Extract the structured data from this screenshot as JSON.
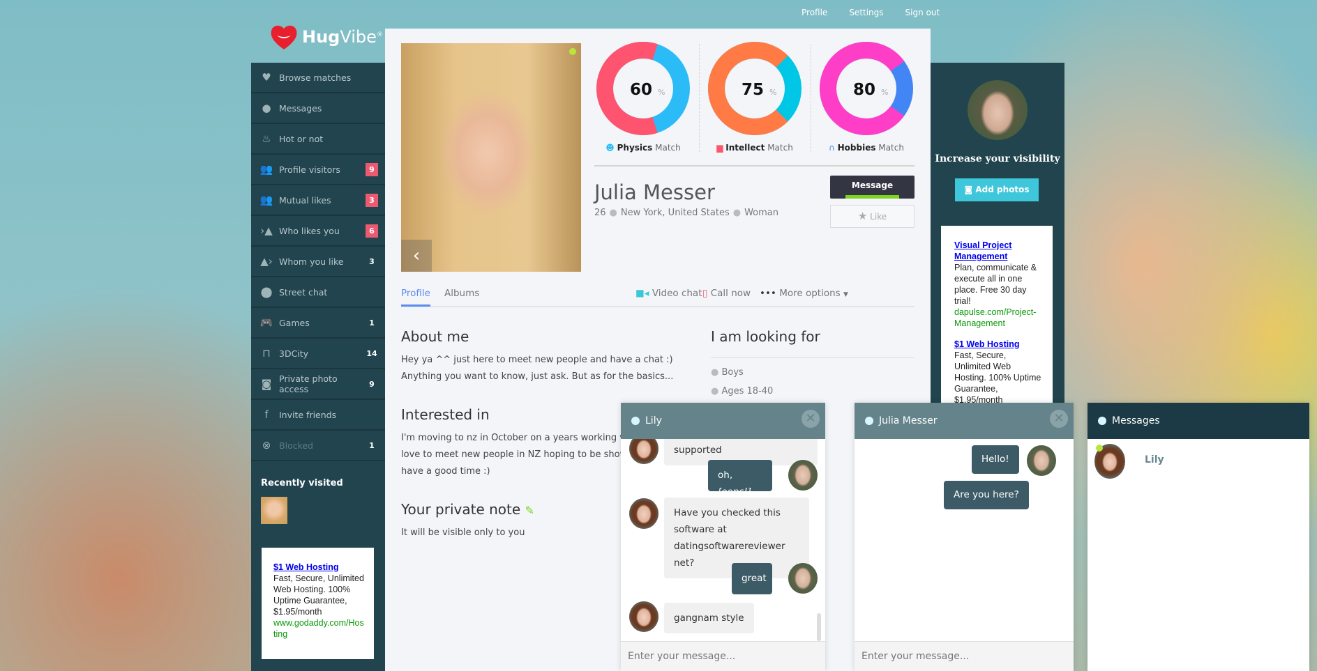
{
  "topnav": {
    "items": [
      "Profile",
      "Settings",
      "Sign out"
    ]
  },
  "logo": {
    "text_bold": "Hug",
    "text_light": "Vibe",
    "mark": "®",
    "brand_color": "#e8202e"
  },
  "sidebar": {
    "items": [
      {
        "label": "Browse matches",
        "icon": "heart-icon",
        "count": null
      },
      {
        "label": "Messages",
        "icon": "chat-bubble-icon",
        "count": null
      },
      {
        "label": "Hot or not",
        "icon": "flame-icon",
        "count": null
      },
      {
        "label": "Profile visitors",
        "icon": "users-icon",
        "count": "9",
        "badge": "red"
      },
      {
        "label": "Mutual likes",
        "icon": "users-heart-icon",
        "count": "3",
        "badge": "red"
      },
      {
        "label": "Who likes you",
        "icon": "user-incoming-icon",
        "count": "6",
        "badge": "red"
      },
      {
        "label": "Whom you like",
        "icon": "user-outgoing-icon",
        "count": "3"
      },
      {
        "label": "Street chat",
        "icon": "map-pin-icon",
        "count": null
      },
      {
        "label": "Games",
        "icon": "gamepad-icon",
        "count": "1"
      },
      {
        "label": "3DCity",
        "icon": "vr-glasses-icon",
        "count": "14"
      },
      {
        "label": "Private photo access",
        "icon": "camera-icon",
        "count": "9"
      },
      {
        "label": "Invite friends",
        "icon": "facebook-icon",
        "count": null
      },
      {
        "label": "Blocked",
        "icon": "blocked-icon",
        "count": "1",
        "dim": true
      }
    ],
    "recently_visited": "Recently visited",
    "ad": {
      "title": "$1 Web Hosting",
      "body": "Fast, Secure, Unlimited Web Hosting. 100% Uptime Guarantee, $1.95/month",
      "url": "www.godaddy.com/Hosting"
    }
  },
  "profile": {
    "name": "Julia Messer",
    "age": "26",
    "location": "New York, United States",
    "gender": "Woman",
    "message_button": "Message",
    "like_button": "Like",
    "matches": [
      {
        "value": 60,
        "display": "60",
        "unit": "%",
        "label_bold": "Physics",
        "label": "Match",
        "colors": [
          "#ff5470",
          "#2bbcf8"
        ],
        "icon": "smiley-icon",
        "icon_color": "#2bbcf8"
      },
      {
        "value": 75,
        "display": "75",
        "unit": "%",
        "label_bold": "Intellect",
        "label": "Match",
        "colors": [
          "#ff7a45",
          "#00c7e6"
        ],
        "icon": "book-icon",
        "icon_color": "#ff5470"
      },
      {
        "value": 80,
        "display": "80",
        "unit": "%",
        "label_bold": "Hobbies",
        "label": "Match",
        "colors": [
          "#ff3ec8",
          "#4385f4"
        ],
        "icon": "headphones-icon",
        "icon_color": "#4385f4"
      }
    ],
    "tabs": [
      {
        "label": "Profile",
        "active": true
      },
      {
        "label": "Albums"
      }
    ],
    "actions": [
      {
        "label": "Video chat",
        "icon": "video-icon"
      },
      {
        "label": "Call now",
        "icon": "phone-icon"
      },
      {
        "label": "More options",
        "icon": "more-dots-icon"
      }
    ],
    "about_title": "About me",
    "about_lines": [
      "Hey ya ^^ just here to meet new people and have a chat :)",
      "Anything you want to know, just ask. But as for the basics..."
    ],
    "interested_title": "Interested in",
    "interested_lines": [
      "I'm moving to nz in October on a years working visa and would",
      "love to meet new people in NZ hoping to be shown around and",
      "have a good time :)"
    ],
    "note_title": "Your private note",
    "note_text": "It will be visible only to you",
    "looking_title": "I am looking for",
    "looking_items": [
      "Boys",
      "Ages 18-40"
    ]
  },
  "right": {
    "visibility_title": "Increase your visibility",
    "add_photos": "Add photos",
    "ads": [
      {
        "title": "Visual Project Management",
        "body": "Plan, communicate & execute all in one place. Free 30 day trial!",
        "url": "dapulse.com/Project-Management"
      },
      {
        "title": "$1 Web Hosting",
        "body": "Fast, Secure, Unlimited Web Hosting. 100% Uptime Guarantee, $1.95/month"
      }
    ]
  },
  "chats": {
    "lily": {
      "title": "Lily",
      "placeholder": "Enter your message...",
      "messages": [
        {
          "from": "them",
          "text": "What languages are supported"
        },
        {
          "from": "me",
          "text": "oh, ",
          "em": "[oops!]"
        },
        {
          "from": "them",
          "text": "Have you checked this software at datingsoftwarereviewer net?"
        },
        {
          "from": "me",
          "text": "great"
        },
        {
          "from": "them",
          "text": "gangnam style"
        }
      ]
    },
    "julia": {
      "title": "Julia Messer",
      "placeholder": "Enter your message...",
      "messages": [
        {
          "from": "me",
          "text": "Hello!"
        },
        {
          "from": "me",
          "text": "Are you here?"
        }
      ]
    },
    "list": {
      "title": "Messages",
      "contacts": [
        {
          "name": "Lily",
          "online": true
        }
      ]
    }
  }
}
